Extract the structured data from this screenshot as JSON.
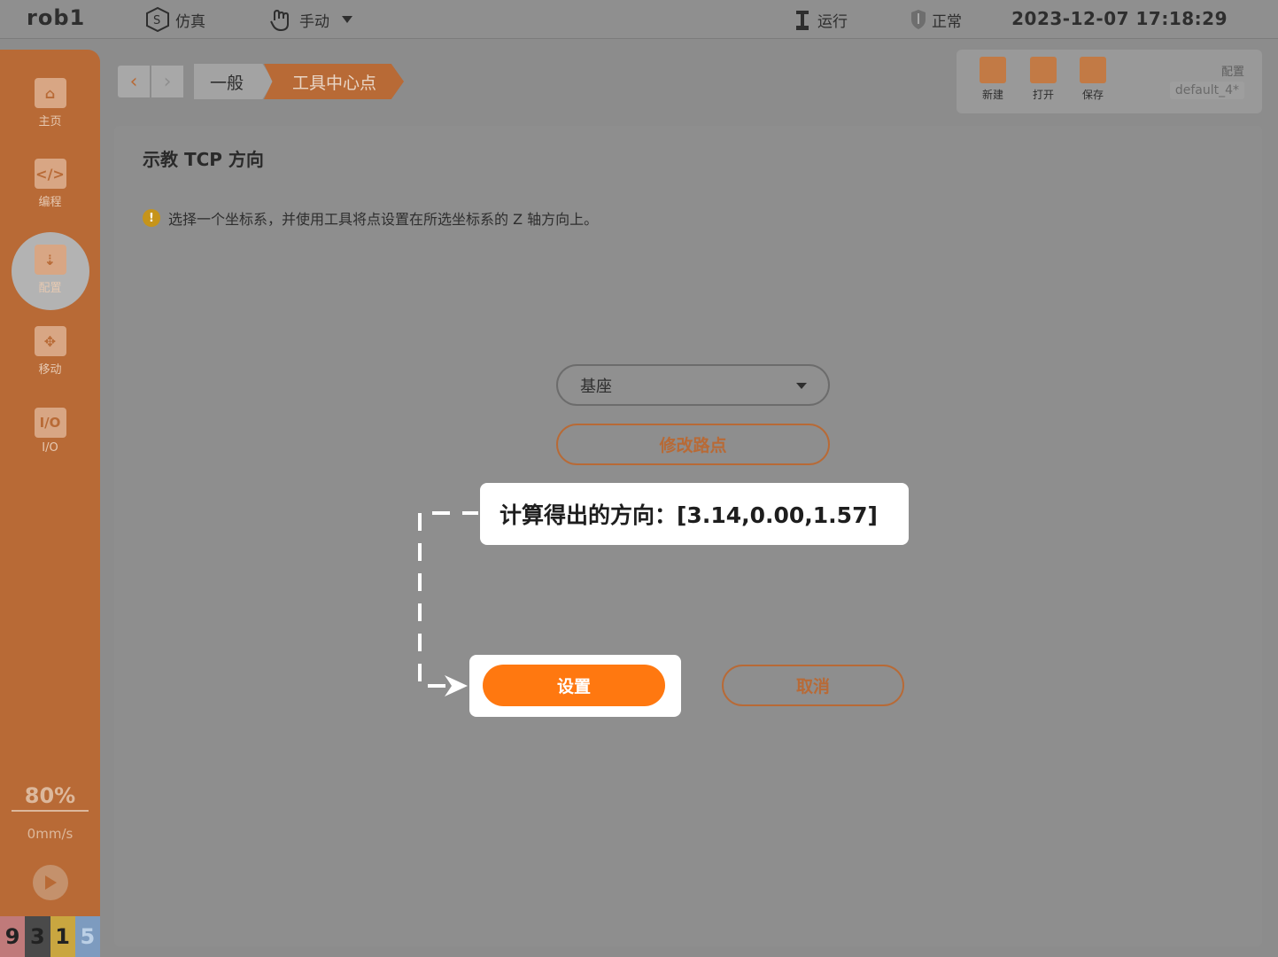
{
  "topbar": {
    "robot_name": "rob1",
    "sim_label": "仿真",
    "mode_label": "手动",
    "run_label": "运行",
    "status_label": "正常",
    "datetime": "2023-12-07 17:18:29"
  },
  "sidebar": {
    "items": [
      {
        "label": "主页",
        "icon": "home-icon"
      },
      {
        "label": "编程",
        "icon": "code-icon"
      },
      {
        "label": "配置",
        "icon": "config-icon"
      },
      {
        "label": "移动",
        "icon": "move-icon"
      },
      {
        "label": "I/O",
        "icon": "io-icon"
      }
    ],
    "active": "配置",
    "speed_percent": "80%",
    "speed_value": "0mm/s",
    "counters": [
      "9",
      "3",
      "1",
      "5"
    ],
    "counter_colors": [
      "#c07a7a",
      "#4a4a4a",
      "#c9a640",
      "#7d9bbf"
    ]
  },
  "breadcrumb": {
    "items": [
      "一般",
      "工具中心点"
    ]
  },
  "file_toolbar": {
    "new_label": "新建",
    "open_label": "打开",
    "save_label": "保存",
    "config_label": "配置",
    "config_value": "default_4*"
  },
  "main": {
    "title": "示教 TCP 方向",
    "info": "选择一个坐标系，并使用工具将点设置在所选坐标系的 Z 轴方向上。",
    "select_value": "基座",
    "modify_label": "修改路点",
    "set_label": "设置",
    "cancel_label": "取消"
  },
  "callout": {
    "text": "计算得出的方向：[3.14,0.00,1.57]"
  },
  "colors": {
    "accent": "#ff7810",
    "sidebar": "#b86a36"
  }
}
